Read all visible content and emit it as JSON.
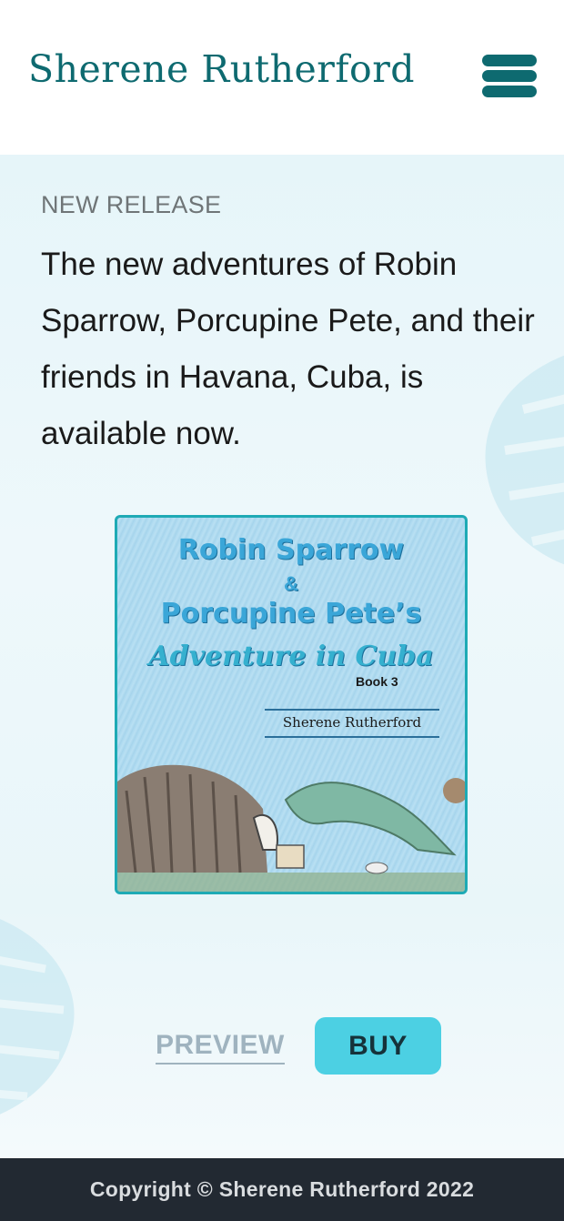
{
  "header": {
    "site_title": "Sherene Rutherford",
    "menu_icon": "hamburger-menu-icon",
    "brand_color": "#0e6a70"
  },
  "hero": {
    "eyebrow": "NEW RELEASE",
    "headline": "The new adventures of Robin Sparrow, Porcupine Pete, and their friends in Havana, Cuba, is available now.",
    "background_icon": "monstera-leaf-icon"
  },
  "book_cover": {
    "title_line1": "Robin Sparrow",
    "ampersand": "&",
    "title_line2": "Porcupine Pete’s",
    "subtitle": "Adventure in Cuba",
    "book_number": "Book 3",
    "author": "Sherene Rutherford",
    "frame_color": "#1eaab5"
  },
  "actions": {
    "preview_label": "PREVIEW",
    "buy_label": "BUY",
    "buy_color": "#4cd0e3"
  },
  "footer": {
    "copyright": "Copyright © Sherene Rutherford 2022"
  }
}
